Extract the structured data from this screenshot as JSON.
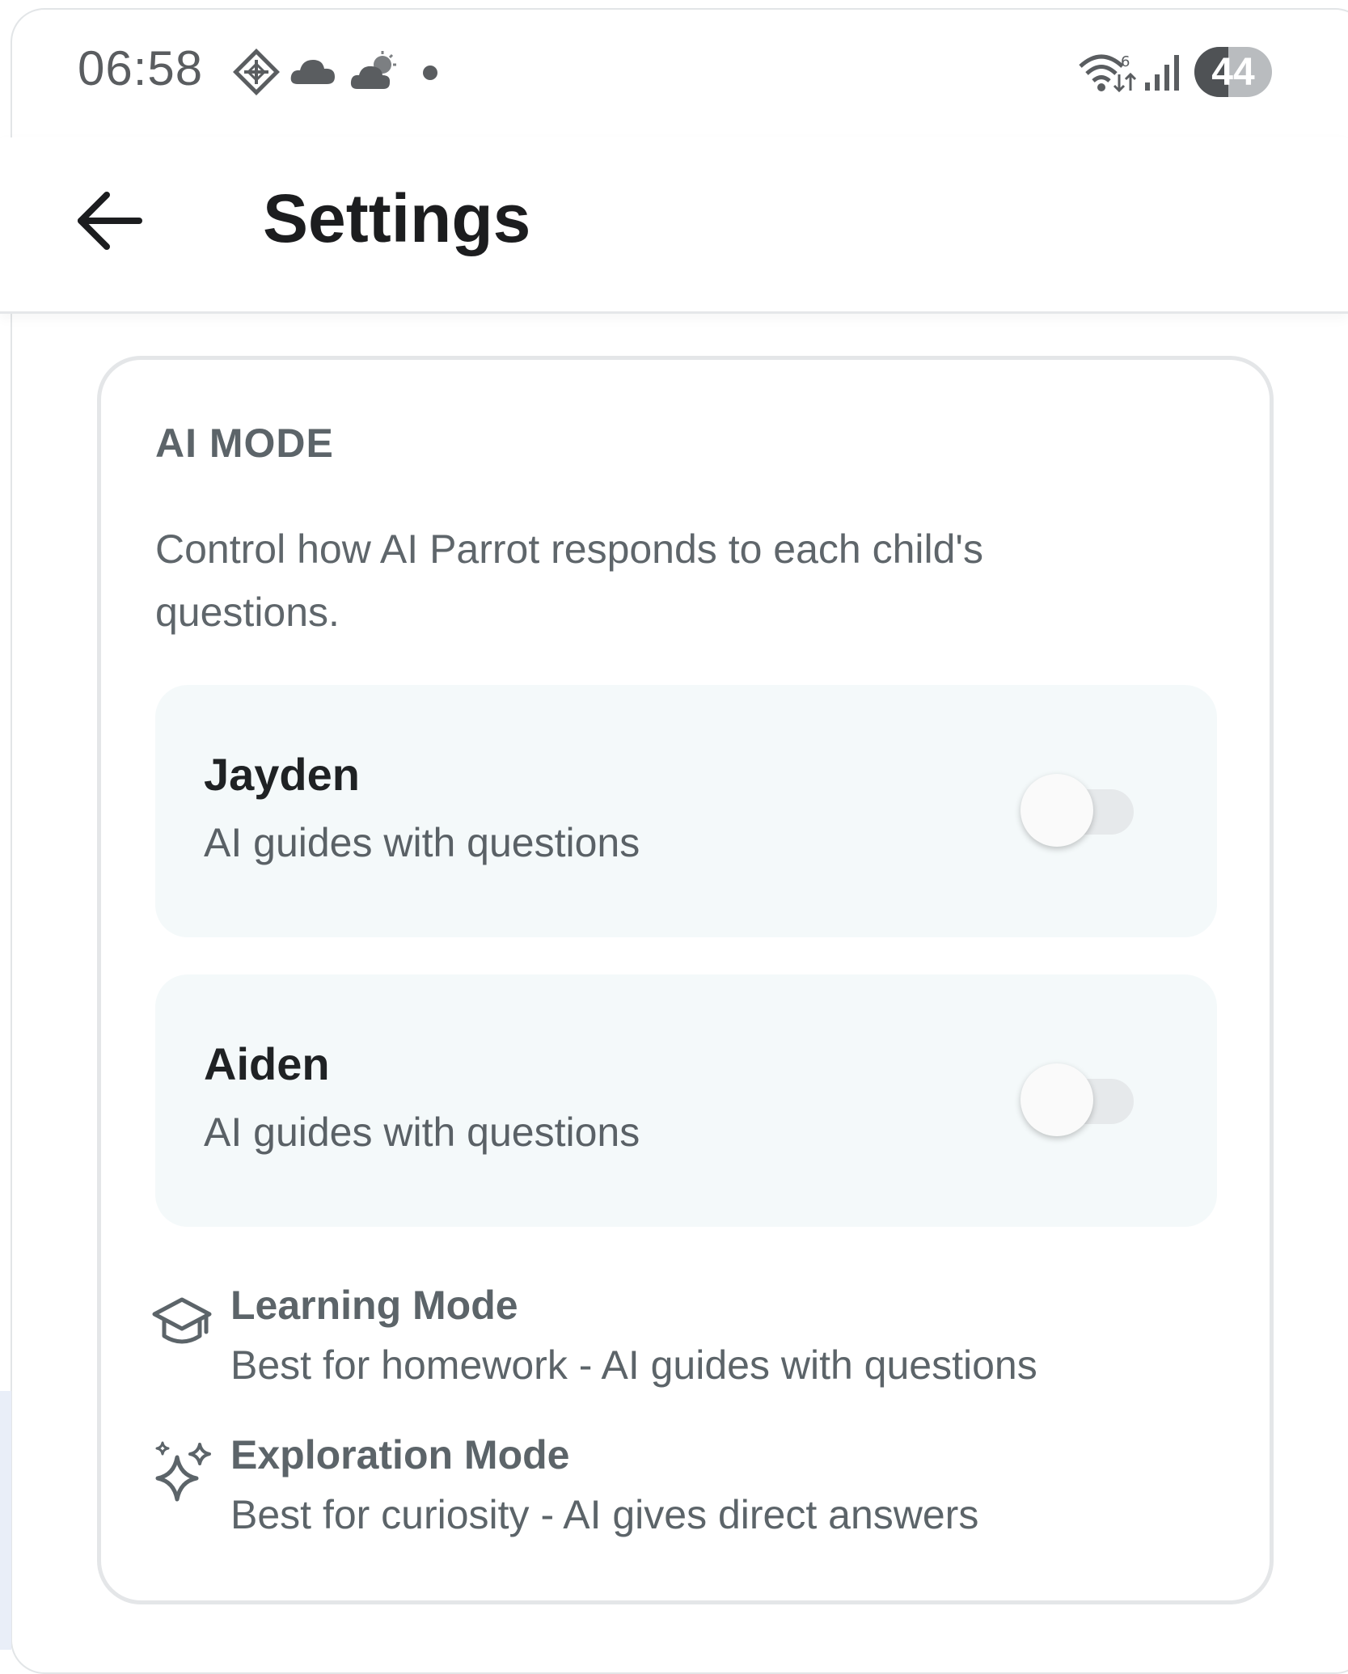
{
  "status_bar": {
    "time": "06:58",
    "battery_level": "44",
    "battery_fraction": 0.44,
    "icons": [
      "diamond-app-icon",
      "cloud-icon",
      "weather-icon",
      "dot-icon",
      "wifi-icon",
      "signal-icon"
    ]
  },
  "header": {
    "title": "Settings",
    "back_icon": "arrow-left-icon"
  },
  "card": {
    "section_title": "AI MODE",
    "description": "Control how AI Parrot responds to each child's questions.",
    "children": [
      {
        "name": "Jayden",
        "mode": "AI guides with questions",
        "toggle_on": false
      },
      {
        "name": "Aiden",
        "mode": "AI guides with questions",
        "toggle_on": false
      }
    ],
    "modes": [
      {
        "icon": "graduation-cap-icon",
        "title": "Learning Mode",
        "description": "Best for homework - AI guides with questions"
      },
      {
        "icon": "sparkles-icon",
        "title": "Exploration Mode",
        "description": "Best for curiosity - AI gives direct answers"
      }
    ]
  },
  "colors": {
    "child_row_bg": "#f4f9fa",
    "title_text": "#1c1d1f",
    "muted_text": "#5c6469",
    "card_border": "#e4e6e8"
  }
}
